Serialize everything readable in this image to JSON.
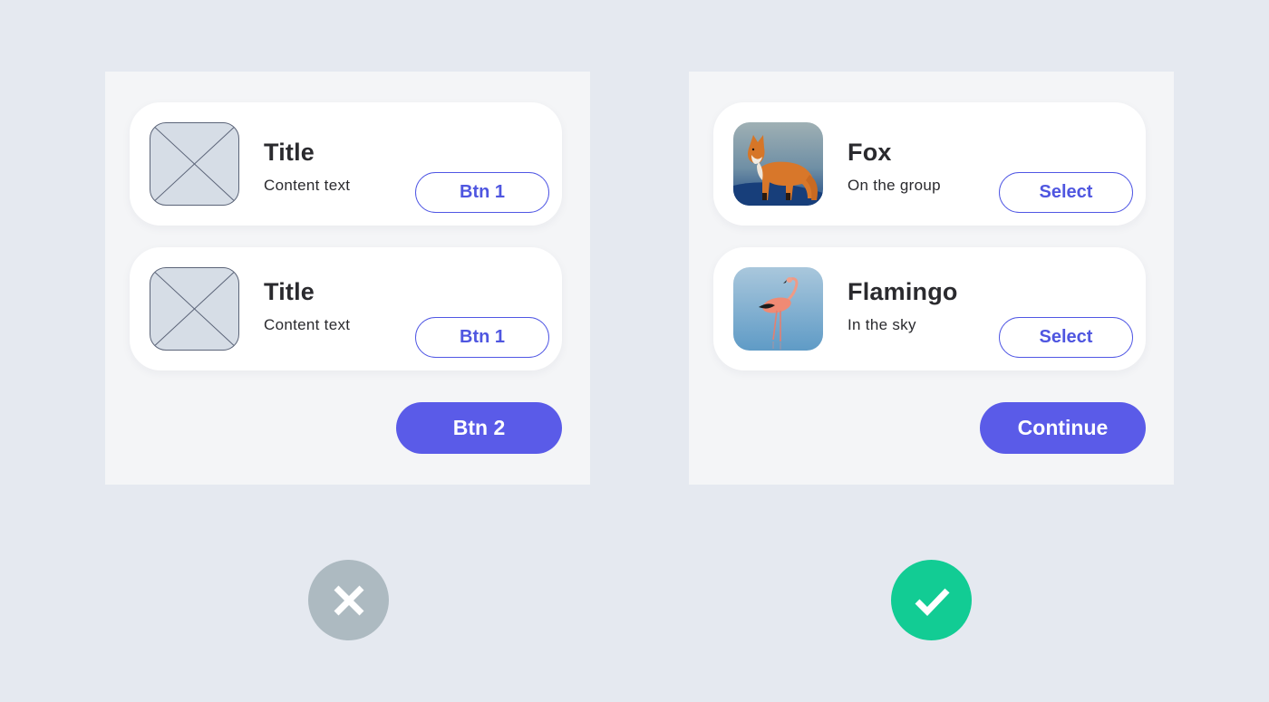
{
  "bad_example": {
    "cards": [
      {
        "title": "Title",
        "text": "Content text",
        "button_label": "Btn 1"
      },
      {
        "title": "Title",
        "text": "Content text",
        "button_label": "Btn 1"
      }
    ],
    "primary_button_label": "Btn 2",
    "indicator_icon": "cross-icon",
    "indicator_color": "#adbac1"
  },
  "good_example": {
    "cards": [
      {
        "title": "Fox",
        "text": "On the group",
        "button_label": "Select",
        "image_icon": "fox-photo"
      },
      {
        "title": "Flamingo",
        "text": "In the sky",
        "button_label": "Select",
        "image_icon": "flamingo-photo"
      }
    ],
    "primary_button_label": "Continue",
    "indicator_icon": "check-icon",
    "indicator_color": "#12cc94"
  },
  "colors": {
    "background": "#e5e9f0",
    "panel": "#f4f5f7",
    "accent": "#5a5be8",
    "text": "#2a2a2e"
  }
}
